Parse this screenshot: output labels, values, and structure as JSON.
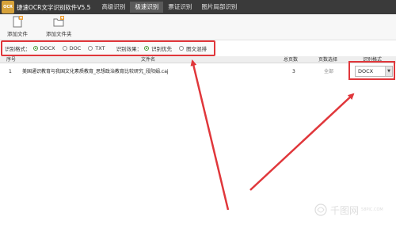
{
  "app": {
    "logo_text": "OCR",
    "title": "捷速OCR文字识别软件V5.5"
  },
  "tabs": [
    {
      "label": "高级识别"
    },
    {
      "label": "极速识别"
    },
    {
      "label": "票证识别"
    },
    {
      "label": "图片局部识别"
    }
  ],
  "active_tab_index": 1,
  "toolbar": {
    "add_file": "添加文件",
    "add_folder": "添加文件夹"
  },
  "options": {
    "format_label": "识别格式：",
    "formats": [
      {
        "label": "DOCX",
        "checked": true
      },
      {
        "label": "DOC",
        "checked": false
      },
      {
        "label": "TXT",
        "checked": false
      }
    ],
    "effect_label": "识别效果：",
    "effects": [
      {
        "label": "识别优先",
        "checked": true
      },
      {
        "label": "图文混排",
        "checked": false
      }
    ]
  },
  "table": {
    "headers": {
      "index": "序号",
      "filename": "文件名",
      "pages": "总页数",
      "page_select": "页数选择",
      "format": "识别格式"
    },
    "rows": [
      {
        "index": "1",
        "filename": "美国通识教育与我国文化素质教育_思想政治教育比较研究_段阳娟.caj",
        "pages": "3",
        "page_select": "全部",
        "format": "DOCX"
      }
    ]
  },
  "watermark": {
    "text": "千图网",
    "sub": "58PIC.COM"
  },
  "colors": {
    "titlebar": "#3a3a3a",
    "highlight_red": "#e0373b",
    "radio_green": "#4a9a3a"
  }
}
